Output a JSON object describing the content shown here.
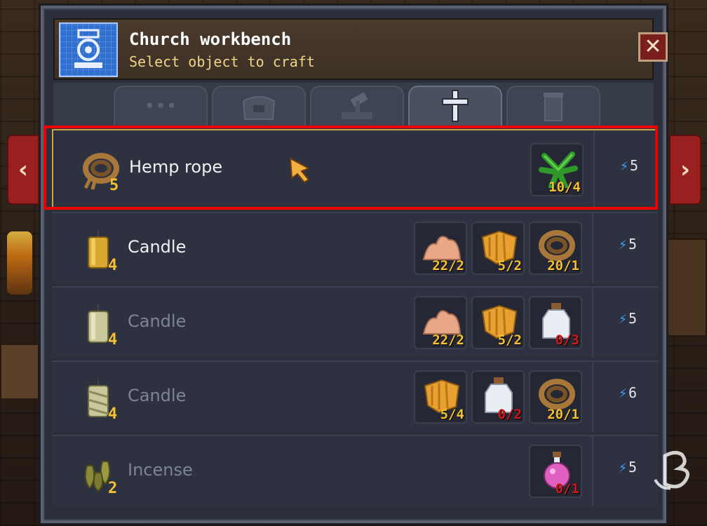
{
  "window": {
    "title": "Church workbench",
    "subtitle": "Select object to craft",
    "close_label": "✕"
  },
  "tabs": [
    {
      "icon": "ellipsis-icon",
      "label": "•••",
      "active": false
    },
    {
      "icon": "bag-icon",
      "label": "",
      "active": false
    },
    {
      "icon": "hammer-icon",
      "label": "",
      "active": false
    },
    {
      "icon": "church-cross-icon",
      "label": "",
      "active": true
    },
    {
      "icon": "barrel-icon",
      "label": "",
      "active": false
    }
  ],
  "nav": {
    "prev_label": "‹",
    "next_label": "›"
  },
  "recipes": [
    {
      "name": "Hemp rope",
      "count": "5",
      "icon": "hemp-rope-icon",
      "state": "selected",
      "ingredients": [
        {
          "icon": "hemp-leaf-icon",
          "qty": "10/4",
          "sufficient": true
        }
      ],
      "energy": "5"
    },
    {
      "name": "Candle",
      "count": "4",
      "icon": "candle-yellow-icon",
      "state": "enabled",
      "ingredients": [
        {
          "icon": "clay-pile-icon",
          "qty": "22/2",
          "sufficient": true
        },
        {
          "icon": "honeycomb-icon",
          "qty": "5/2",
          "sufficient": true
        },
        {
          "icon": "hemp-rope-icon",
          "qty": "20/1",
          "sufficient": true
        }
      ],
      "energy": "5"
    },
    {
      "name": "Candle",
      "count": "4",
      "icon": "candle-pale-icon",
      "state": "disabled",
      "ingredients": [
        {
          "icon": "clay-pile-icon",
          "qty": "22/2",
          "sufficient": true
        },
        {
          "icon": "honeycomb-icon",
          "qty": "5/2",
          "sufficient": true
        },
        {
          "icon": "bottle-icon",
          "qty": "0/3",
          "sufficient": false
        }
      ],
      "energy": "5"
    },
    {
      "name": "Candle",
      "count": "4",
      "icon": "candle-striped-icon",
      "state": "disabled",
      "ingredients": [
        {
          "icon": "honeycomb-icon",
          "qty": "5/4",
          "sufficient": true
        },
        {
          "icon": "bottle-icon",
          "qty": "0/2",
          "sufficient": false
        },
        {
          "icon": "hemp-rope-icon",
          "qty": "20/1",
          "sufficient": true
        }
      ],
      "energy": "6"
    },
    {
      "name": "Incense",
      "count": "2",
      "icon": "incense-icon",
      "state": "disabled",
      "ingredients": [
        {
          "icon": "pink-potion-icon",
          "qty": "0/1",
          "sufficient": false
        }
      ],
      "energy": "5"
    }
  ],
  "colors": {
    "selection_outline": "#ee0000",
    "qty_ok": "#f5c030",
    "qty_missing": "#d01818",
    "energy_bolt": "#3fa0ff"
  }
}
